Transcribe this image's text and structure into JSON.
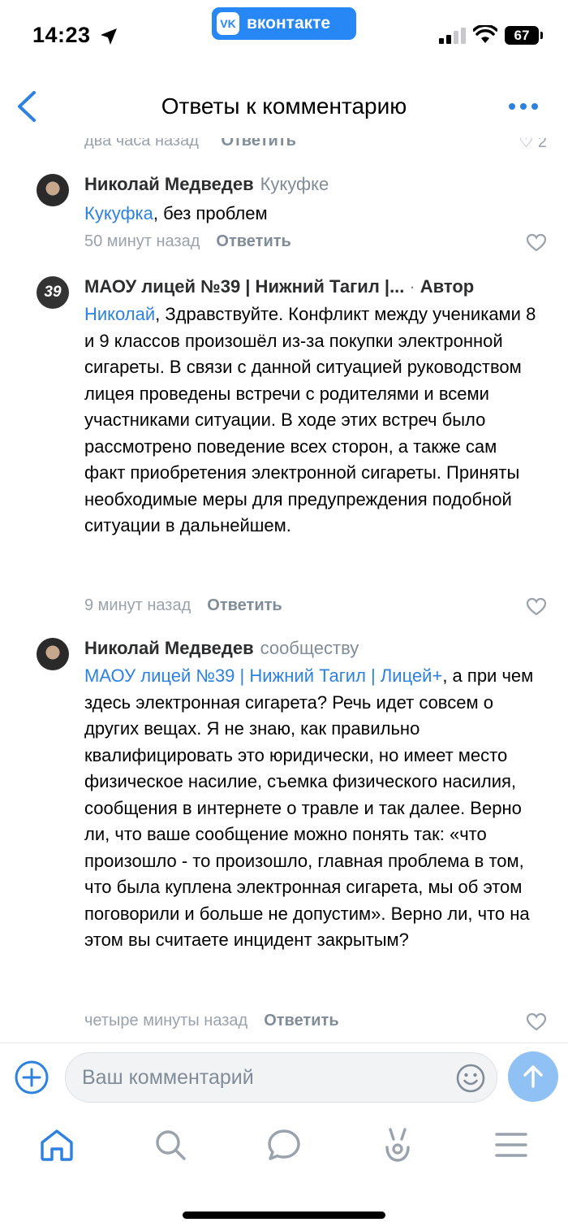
{
  "status": {
    "time": "14:23",
    "battery": "67",
    "app_badge": "вконтакте"
  },
  "nav": {
    "title": "Ответы к комментарию"
  },
  "partial": {
    "time": "два часа назад",
    "reply": "Ответить",
    "likes": "2"
  },
  "comments": [
    {
      "author": "Николай Медведев",
      "to": "Кукуфке",
      "mention": "Кукуфка",
      "text": ", без проблем",
      "time": "50 минут назад",
      "reply": "Ответить"
    },
    {
      "author": "МАОУ лицей №39 | Нижний Тагил |...",
      "dot": "·",
      "role": "Автор",
      "avatar_text": "39",
      "mention": "Николай",
      "text": ", Здравствуйте. Конфликт между учениками 8 и 9 классов произошёл из-за покупки электронной сигареты. В связи с данной ситуацией руководством лицея проведены встречи с родителями и всеми участниками ситуации. В ходе этих встреч было рассмотрено поведение всех сторон, а также сам факт приобретения электронной сигареты. Приняты необходимые меры для предупреждения подобной ситуации в дальнейшем.",
      "time": "9 минут назад",
      "reply": "Ответить"
    },
    {
      "author": "Николай Медведев",
      "to": "сообществу",
      "mention": "МАОУ лицей №39 | Нижний Тагил | Лицей+",
      "text": ", а при чем здесь электронная сигарета? Речь идет совсем о других вещах. Я не знаю, как правильно квалифицировать это юридически, но имеет место физическое насилие, съемка физического насилия, сообщения в интернете о травле и так далее. Верно ли, что ваше сообщение можно понять так: «что произошло - то произошло, главная проблема в том, что была куплена электронная сигарета, мы об этом поговорили и больше не допустим». Верно ли, что на этом вы считаете инцидент закрытым?",
      "time": "четыре минуты назад",
      "reply": "Ответить"
    }
  ],
  "composer": {
    "placeholder": "Ваш комментарий"
  },
  "colors": {
    "accent": "#2d81e0",
    "secondary": "#818c99",
    "send_disabled": "#8fc1f5"
  },
  "icons": [
    "back-chevron-icon",
    "more-dots-icon",
    "heart-icon",
    "plus-circle-icon",
    "smile-icon",
    "send-arrow-icon",
    "home-icon",
    "search-icon",
    "messages-icon",
    "clips-icon",
    "menu-icon"
  ]
}
